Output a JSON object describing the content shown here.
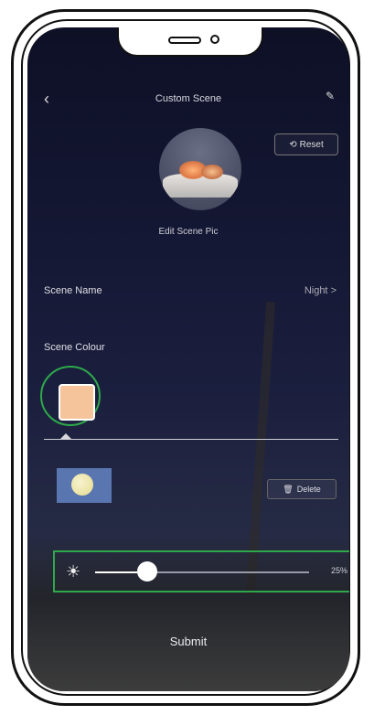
{
  "header": {
    "back_icon": "chevron-left-icon",
    "title": "Custom Scene",
    "edit_icon": "pencil-icon"
  },
  "reset": {
    "label": "Reset",
    "icon": "refresh-icon"
  },
  "scene_picture": {
    "label": "Edit Scene Pic"
  },
  "scene_name": {
    "label": "Scene Name",
    "value": "Night",
    "chevron": ">"
  },
  "scene_colour": {
    "label": "Scene Colour",
    "selected_color": "#f6c49a"
  },
  "delete": {
    "label": "Delete",
    "icon": "trash-icon"
  },
  "brightness": {
    "icon": "sun-icon",
    "value": 25,
    "label": "25%"
  },
  "submit": {
    "label": "Submit"
  },
  "colors": {
    "highlight": "#2ea84a",
    "preview_tile": "#5a76b0"
  }
}
